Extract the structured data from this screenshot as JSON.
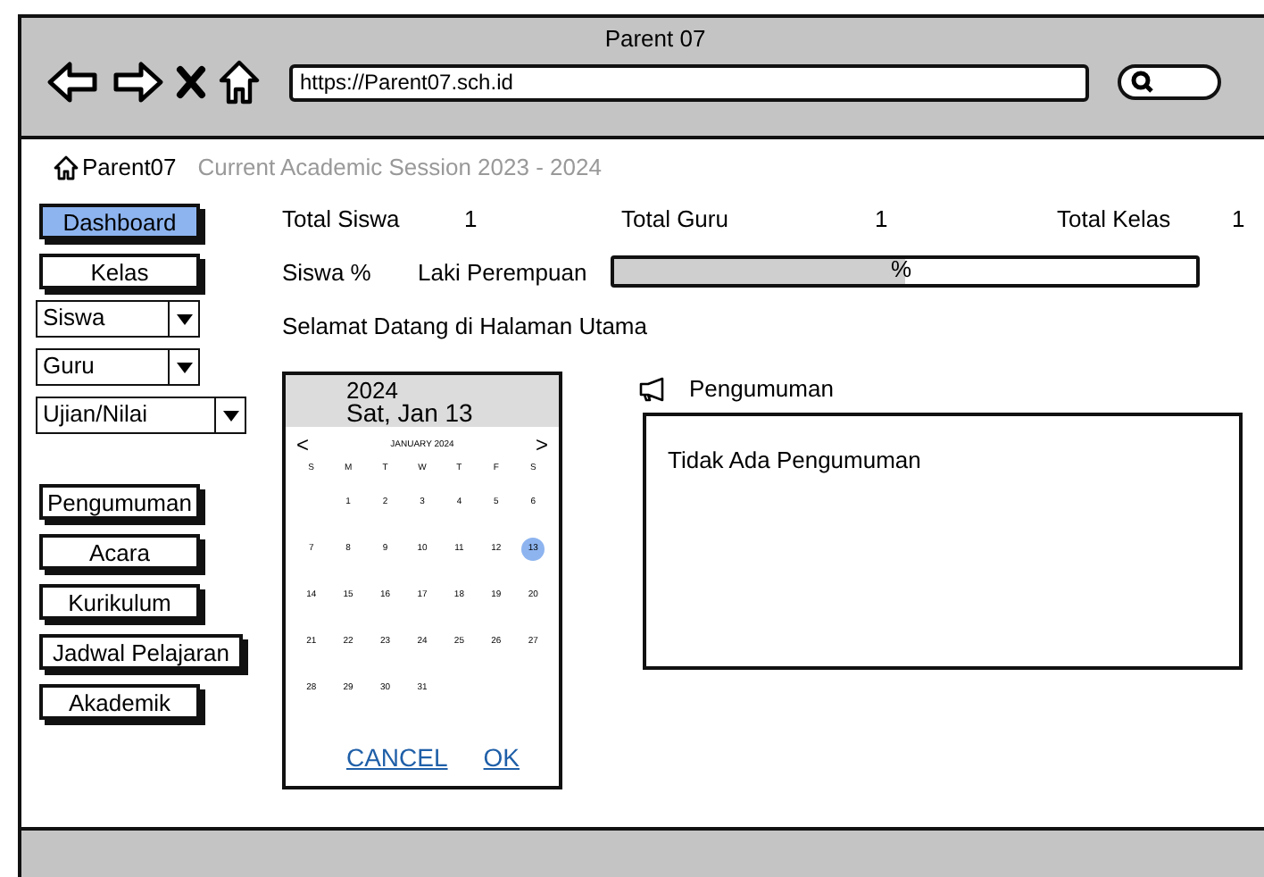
{
  "window": {
    "title": "Parent 07"
  },
  "browser": {
    "url": "https://Parent07.sch.id"
  },
  "breadcrumb": {
    "home": "Parent07",
    "session": "Current Academic Session 2023 - 2024"
  },
  "sidebar": {
    "items": [
      {
        "kind": "button",
        "label": "Dashboard",
        "selected": true
      },
      {
        "kind": "button",
        "label": "Kelas",
        "selected": false
      },
      {
        "kind": "dropdown",
        "label": "Siswa",
        "selected": false
      },
      {
        "kind": "dropdown",
        "label": "Guru",
        "selected": false
      },
      {
        "kind": "dropdown",
        "label": "Ujian/Nilai",
        "selected": false
      },
      {
        "kind": "gap"
      },
      {
        "kind": "button",
        "label": "Pengumuman",
        "selected": false
      },
      {
        "kind": "button",
        "label": "Acara",
        "selected": false
      },
      {
        "kind": "button",
        "label": "Kurikulum",
        "selected": false
      },
      {
        "kind": "button",
        "label": "Jadwal Pelajaran",
        "selected": false
      },
      {
        "kind": "button",
        "label": "Akademik",
        "selected": false
      }
    ]
  },
  "stats": [
    {
      "label": "Total Siswa",
      "value": "1"
    },
    {
      "label": "Total Guru",
      "value": "1"
    },
    {
      "label": "Total Kelas",
      "value": "1"
    }
  ],
  "ratio": {
    "label": "Siswa %",
    "caption": "Laki Perempuan",
    "level": 0.5,
    "reading": "%"
  },
  "welcome": "Selamat Datang di Halaman Utama",
  "calendar": {
    "year": "2024",
    "date": "Sat, Jan 13",
    "prev": "<",
    "next": ">",
    "month": "JANUARY 2024",
    "weekdays": [
      "S",
      "M",
      "T",
      "W",
      "T",
      "F",
      "S"
    ],
    "days": [
      {
        "kind": "blank"
      },
      {
        "kind": "day",
        "day": "1",
        "selected": false
      },
      {
        "kind": "day",
        "day": "2",
        "selected": false
      },
      {
        "kind": "day",
        "day": "3",
        "selected": false
      },
      {
        "kind": "day",
        "day": "4",
        "selected": false
      },
      {
        "kind": "day",
        "day": "5",
        "selected": false
      },
      {
        "kind": "day",
        "day": "6",
        "selected": false
      },
      {
        "kind": "day",
        "day": "7",
        "selected": false
      },
      {
        "kind": "day",
        "day": "8",
        "selected": false
      },
      {
        "kind": "day",
        "day": "9",
        "selected": false
      },
      {
        "kind": "day",
        "day": "10",
        "selected": false
      },
      {
        "kind": "day",
        "day": "11",
        "selected": false
      },
      {
        "kind": "day",
        "day": "12",
        "selected": false
      },
      {
        "kind": "day",
        "day": "13",
        "selected": true
      },
      {
        "kind": "day",
        "day": "14",
        "selected": false
      },
      {
        "kind": "day",
        "day": "15",
        "selected": false
      },
      {
        "kind": "day",
        "day": "16",
        "selected": false
      },
      {
        "kind": "day",
        "day": "17",
        "selected": false
      },
      {
        "kind": "day",
        "day": "18",
        "selected": false
      },
      {
        "kind": "day",
        "day": "19",
        "selected": false
      },
      {
        "kind": "day",
        "day": "20",
        "selected": false
      },
      {
        "kind": "day",
        "day": "21",
        "selected": false
      },
      {
        "kind": "day",
        "day": "22",
        "selected": false
      },
      {
        "kind": "day",
        "day": "23",
        "selected": false
      },
      {
        "kind": "day",
        "day": "24",
        "selected": false
      },
      {
        "kind": "day",
        "day": "25",
        "selected": false
      },
      {
        "kind": "day",
        "day": "26",
        "selected": false
      },
      {
        "kind": "day",
        "day": "27",
        "selected": false
      },
      {
        "kind": "day",
        "day": "28",
        "selected": false
      },
      {
        "kind": "day",
        "day": "29",
        "selected": false
      },
      {
        "kind": "day",
        "day": "30",
        "selected": false
      },
      {
        "kind": "day",
        "day": "31",
        "selected": false
      }
    ],
    "buttons": [
      "CANCEL",
      "OK"
    ]
  },
  "announcements": {
    "title": "Pengumuman",
    "text": "Tidak Ada Pengumuman"
  }
}
